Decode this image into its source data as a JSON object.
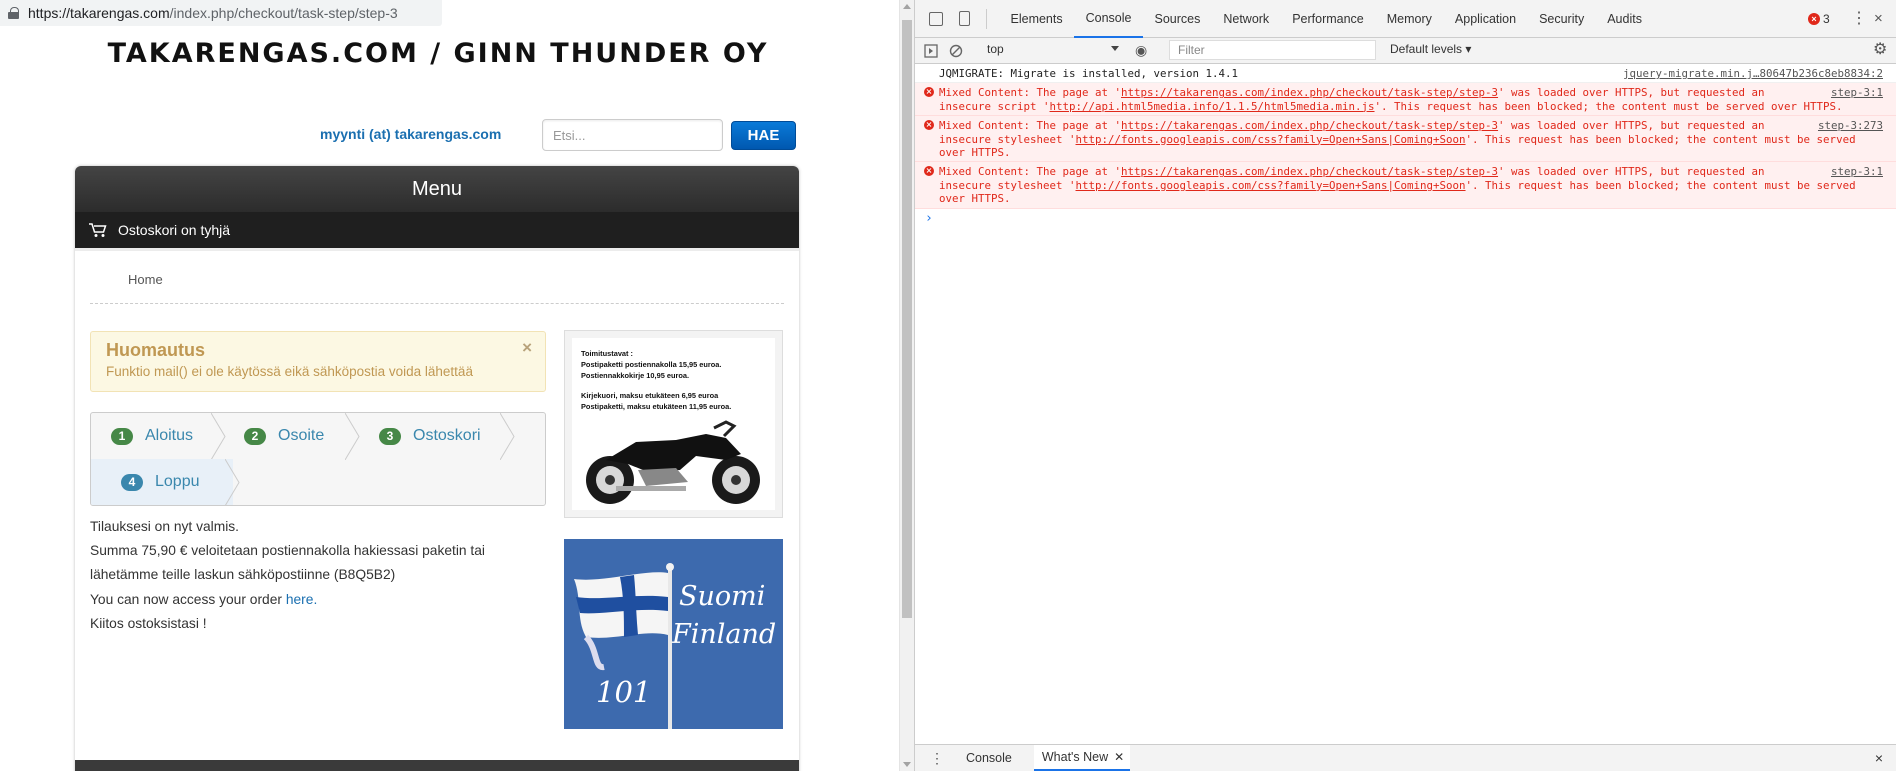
{
  "browser": {
    "url_host": "https://takarengas.com",
    "url_path": "/index.php/checkout/task-step/step-3"
  },
  "site": {
    "title": "Takarengas.com / Ginn Thunder Oy",
    "contact": "myynti (at) takarengas.com",
    "search_placeholder": "Etsi...",
    "search_button": "HAE",
    "menu_label": "Menu",
    "cart_label": "Ostoskori on tyhjä",
    "breadcrumb_home": "Home"
  },
  "notice": {
    "title": "Huomautus",
    "message": "Funktio mail() ei ole käytössä eikä sähköpostia voida lähettää",
    "close": "×"
  },
  "steps": [
    {
      "num": "1",
      "label": "Aloitus"
    },
    {
      "num": "2",
      "label": "Osoite"
    },
    {
      "num": "3",
      "label": "Ostoskori"
    },
    {
      "num": "4",
      "label": "Loppu"
    }
  ],
  "order": {
    "line1": "Tilauksesi on nyt valmis.",
    "line2": "Summa 75,90 € veloitetaan postiennakolla hakiessasi paketin tai",
    "line3": "lähetämme teille laskun sähköpostiinne (B8Q5B2)",
    "line4_pre": "You can now access your order ",
    "line4_link": "here.",
    "line5": "Kiitos ostoksistasi !"
  },
  "promo": {
    "heading": "Toimitustavat :",
    "l1": "Postipaketti postiennakolla 15,95 euroa.",
    "l2": "Postiennakkokirje 10,95 euroa.",
    "l3": "Kirjekuori, maksu etukäteen 6,95 euroa",
    "l4": "Postipaketti, maksu etukäteen 11,95 euroa."
  },
  "banner": {
    "w1": "Suomi",
    "w2": "Finland",
    "num": "101"
  },
  "devtools": {
    "tabs": [
      "Elements",
      "Console",
      "Sources",
      "Network",
      "Performance",
      "Memory",
      "Application",
      "Security",
      "Audits"
    ],
    "active_tab": "Console",
    "error_count": "3",
    "context": "top",
    "filter_placeholder": "Filter",
    "levels": "Default levels ▾",
    "log": [
      {
        "type": "info",
        "text": "JQMIGRATE: Migrate is installed, version 1.4.1",
        "source": "jquery-migrate.min.j…80647b236c8eb8834:2"
      },
      {
        "type": "error",
        "l1a": "Mixed Content: The page at '",
        "l1url": "https://takarengas.com/index.php/checkout/task-step/step-3",
        "l1b": "' was loaded over HTTPS, but requested an",
        "l2a": "insecure script '",
        "l2url": "http://api.html5media.info/1.1.5/html5media.min.js",
        "l2b": "'. This request has been blocked; the content must be served over HTTPS.",
        "l3": "",
        "source": "step-3:1"
      },
      {
        "type": "error",
        "l1a": "Mixed Content: The page at '",
        "l1url": "https://takarengas.com/index.php/checkout/task-step/step-3",
        "l1b": "' was loaded over HTTPS, but requested an",
        "l2a": "insecure stylesheet '",
        "l2url": "http://fonts.googleapis.com/css?family=Open+Sans|Coming+Soon",
        "l2b": "'. This request has been blocked; the content must be served",
        "l3": "over HTTPS.",
        "source": "step-3:273"
      },
      {
        "type": "error",
        "l1a": "Mixed Content: The page at '",
        "l1url": "https://takarengas.com/index.php/checkout/task-step/step-3",
        "l1b": "' was loaded over HTTPS, but requested an",
        "l2a": "insecure stylesheet '",
        "l2url": "http://fonts.googleapis.com/css?family=Open+Sans|Coming+Soon",
        "l2b": "'. This request has been blocked; the content must be served",
        "l3": "over HTTPS.",
        "source": "step-3:1"
      }
    ],
    "prompt": "›",
    "drawer_tabs": [
      "Console",
      "What's New"
    ],
    "drawer_close": "×"
  }
}
